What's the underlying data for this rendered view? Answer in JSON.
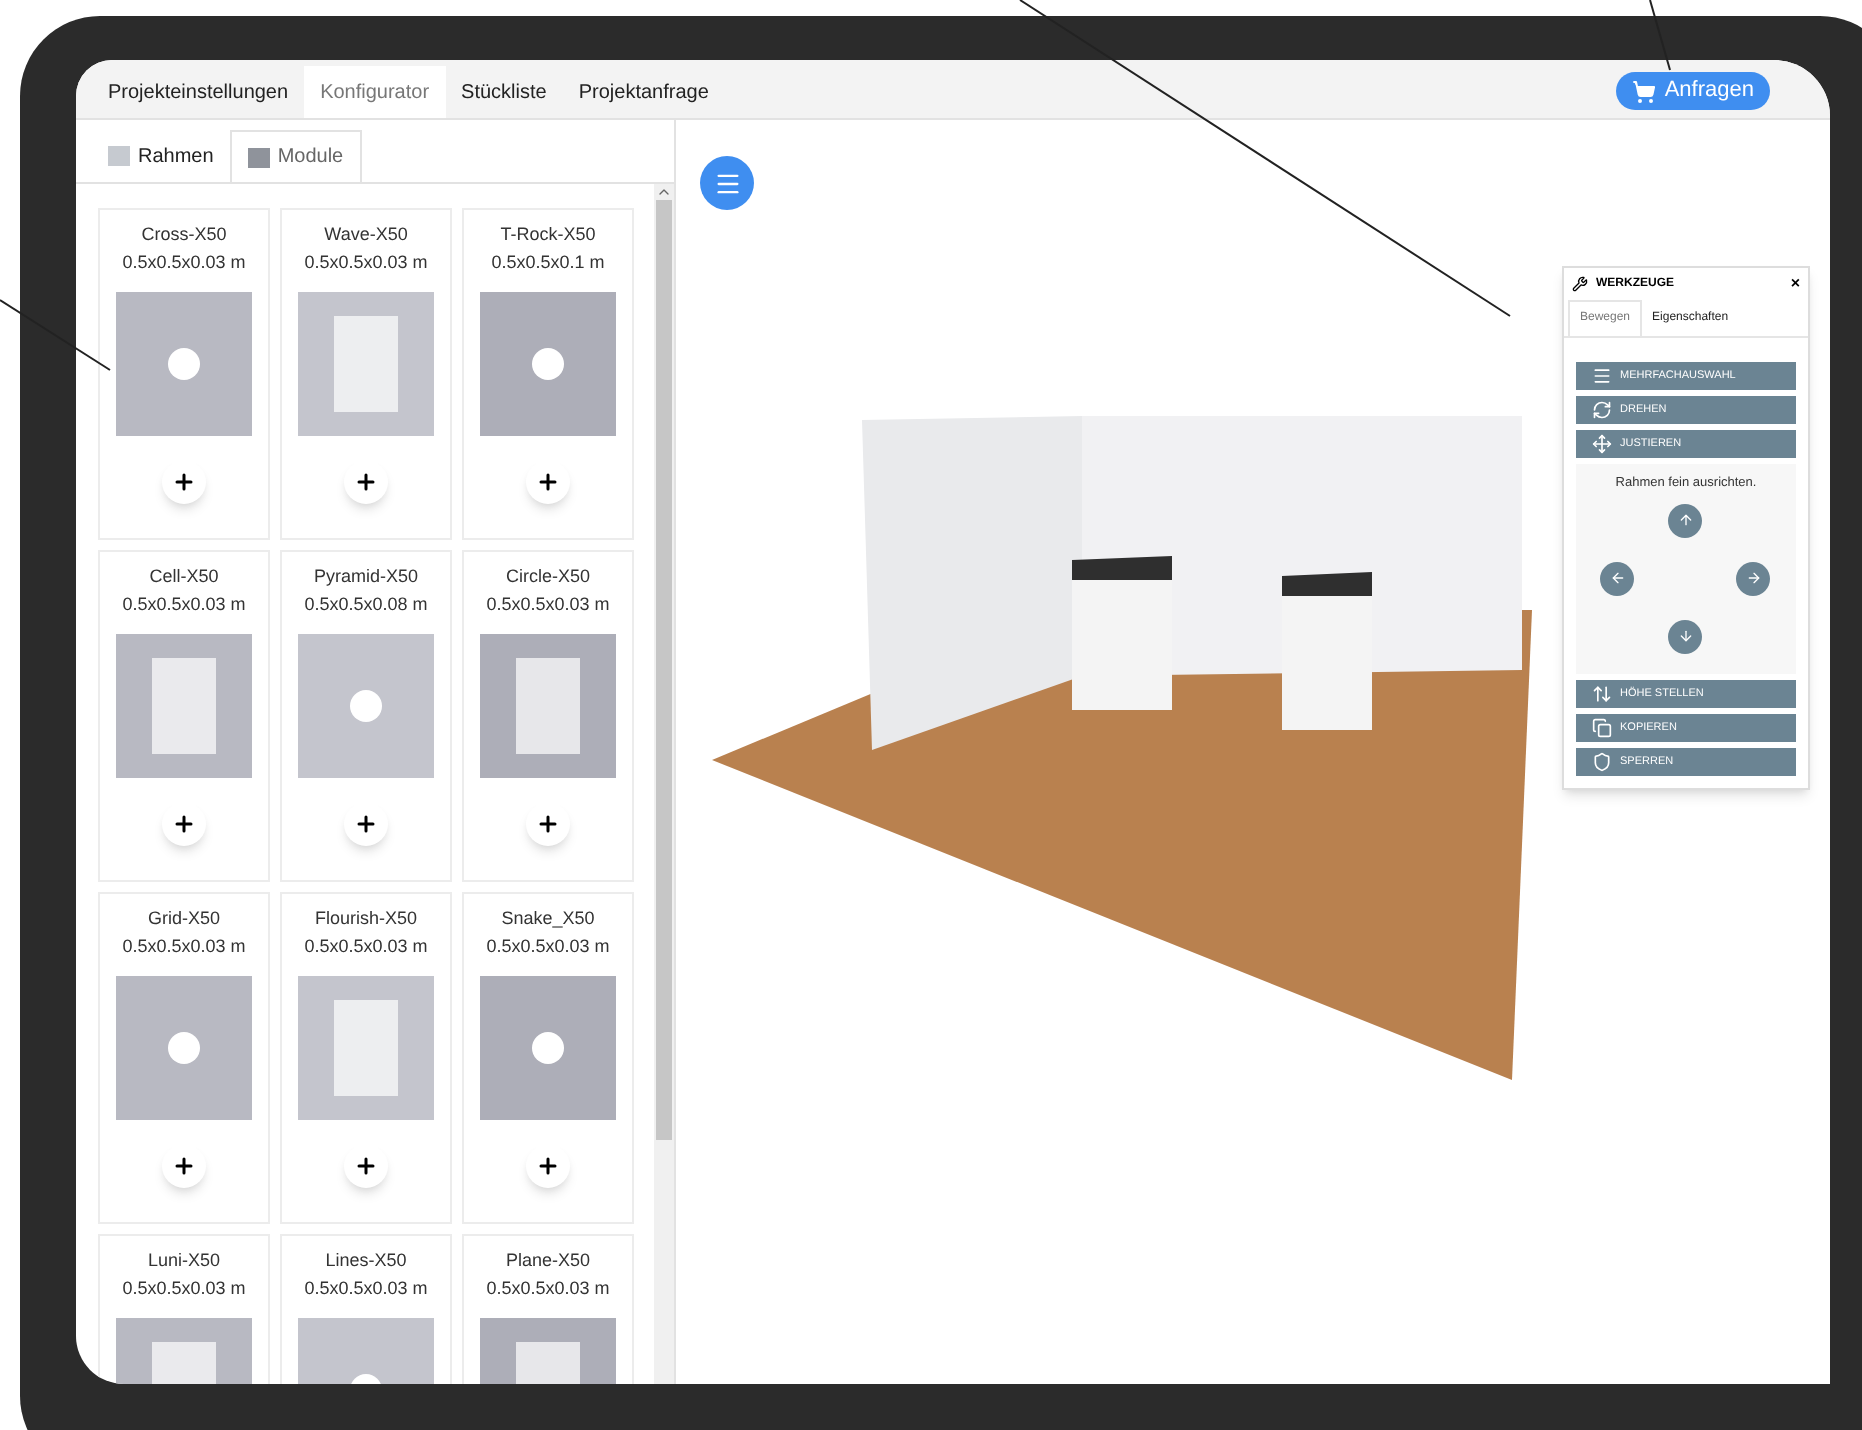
{
  "main_tabs": [
    {
      "label": "Projekteinstellungen",
      "selected": false
    },
    {
      "label": "Konfigurator",
      "selected": true
    },
    {
      "label": "Stückliste",
      "selected": false
    },
    {
      "label": "Projektanfrage",
      "selected": false
    }
  ],
  "request_button": {
    "label": "Anfragen"
  },
  "sub_tabs": [
    {
      "label": "Rahmen",
      "selected": false
    },
    {
      "label": "Module",
      "selected": true
    }
  ],
  "modules": [
    {
      "name": "Cross-X50",
      "size": "0.5x0.5x0.03 m"
    },
    {
      "name": "Wave-X50",
      "size": "0.5x0.5x0.03 m"
    },
    {
      "name": "T-Rock-X50",
      "size": "0.5x0.5x0.1 m"
    },
    {
      "name": "Cell-X50",
      "size": "0.5x0.5x0.03 m"
    },
    {
      "name": "Pyramid-X50",
      "size": "0.5x0.5x0.08 m"
    },
    {
      "name": "Circle-X50",
      "size": "0.5x0.5x0.03 m"
    },
    {
      "name": "Grid-X50",
      "size": "0.5x0.5x0.03 m"
    },
    {
      "name": "Flourish-X50",
      "size": "0.5x0.5x0.03 m"
    },
    {
      "name": "Snake_X50",
      "size": "0.5x0.5x0.03 m"
    },
    {
      "name": "Luni-X50",
      "size": "0.5x0.5x0.03 m"
    },
    {
      "name": "Lines-X50",
      "size": "0.5x0.5x0.03 m"
    },
    {
      "name": "Plane-X50",
      "size": "0.5x0.5x0.03 m"
    }
  ],
  "tools": {
    "title": "WERKZEUGE",
    "close": "×",
    "tabs": [
      {
        "label": "Bewegen",
        "selected": true
      },
      {
        "label": "Eigenschaften",
        "selected": false
      }
    ],
    "actions_top": [
      {
        "label": "MEHRFACHAUSWAHL",
        "kind": "menu"
      },
      {
        "label": "DREHEN",
        "kind": "rotate"
      },
      {
        "label": "JUSTIEREN",
        "kind": "move"
      }
    ],
    "adjust_hint": "Rahmen fein ausrichten.",
    "actions_bottom": [
      {
        "label": "HÖHE STELLEN",
        "kind": "height"
      },
      {
        "label": "KOPIEREN",
        "kind": "copy"
      },
      {
        "label": "SPERREN",
        "kind": "lock"
      }
    ]
  }
}
